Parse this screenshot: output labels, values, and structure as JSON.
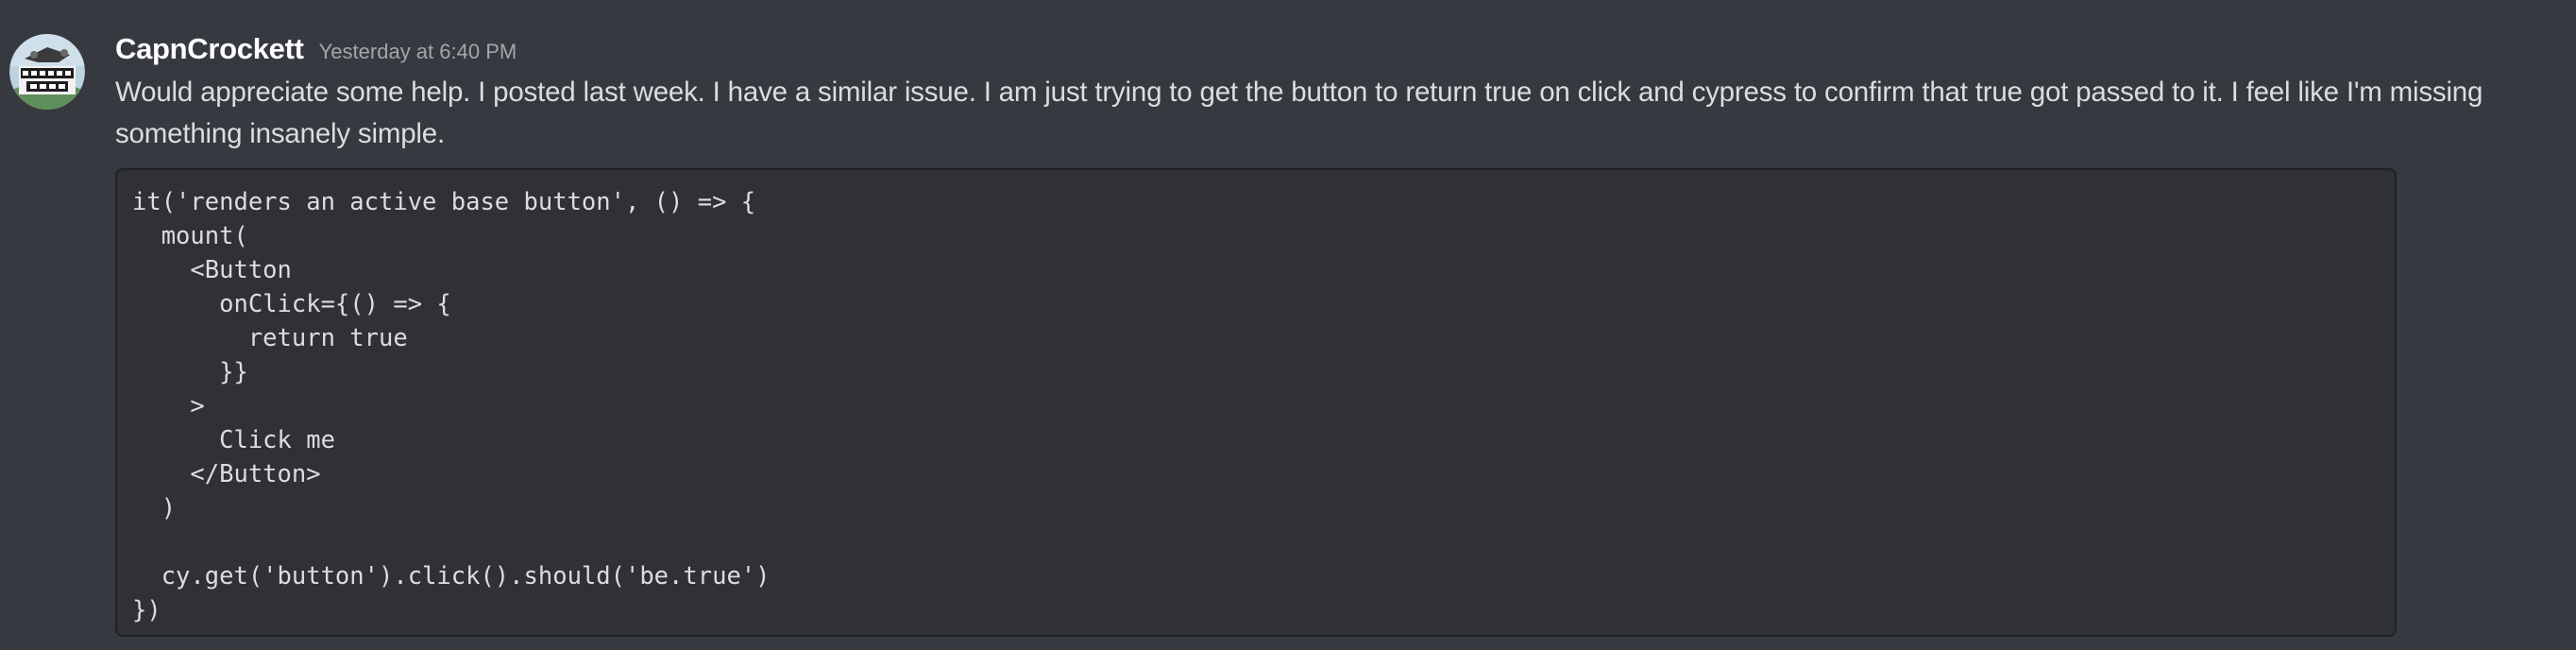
{
  "message": {
    "author": "CapnCrockett",
    "timestamp": "Yesterday at 6:40 PM",
    "text": "Would appreciate some help. I posted last week. I have a similar issue. I am just trying to get the button to return true on click and cypress to confirm that true got passed to it. I feel like I'm missing something insanely simple.",
    "code": "it('renders an active base button', () => {\n  mount(\n    <Button\n      onClick={() => {\n        return true\n      }}\n    >\n      Click me\n    </Button>\n  )\n\n  cy.get('button').click().should('be.true')\n})"
  },
  "colors": {
    "background": "#36393f",
    "code_background": "#2f3136",
    "code_border": "#202225",
    "username": "#ffffff",
    "timestamp": "#a3a6aa",
    "text": "#dcddde"
  },
  "icons": {
    "avatar": "avatar-image"
  }
}
